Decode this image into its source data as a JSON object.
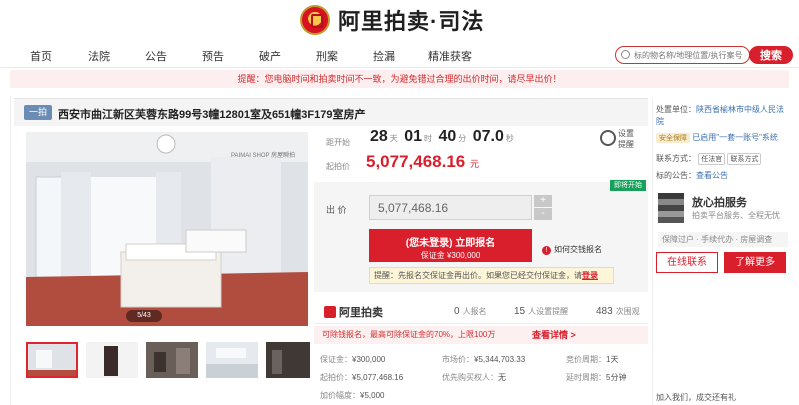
{
  "header": {
    "logo_text": "阿里拍卖·司法"
  },
  "nav": {
    "items": [
      "首页",
      "法院",
      "公告",
      "预告",
      "破产",
      "刑案",
      "捡漏",
      "精准获客"
    ],
    "search_placeholder": "标的物名称/地理位置/执行案号",
    "search_button": "搜索"
  },
  "notice": "提醒：您电脑时间和拍卖时间不一致，为避免错过合理的出价时间，请尽早出价！",
  "title": {
    "tag": "一拍",
    "text": "西安市曲江新区芙蓉东路99号3幢12801室及651幢3F179室房产"
  },
  "photo": {
    "counter": "5/43"
  },
  "auction": {
    "countdown_label": "距开始",
    "days": "28",
    "days_unit": "天",
    "hours": "01",
    "hours_unit": "时",
    "minutes": "40",
    "minutes_unit": "分",
    "seconds": "07.0",
    "seconds_unit": "秒",
    "start_price_label": "起拍价",
    "start_price": "5,077,468.16",
    "price_unit": "元",
    "remind_label": "设置提醒",
    "status_tag": "即将开始",
    "bid_label": "出  价",
    "bid_value": "5,077,468.16",
    "step_up": "+",
    "step_down": "-",
    "register_button": "(您未登录) 立即报名",
    "register_sub": "保证金 ¥300,000",
    "howto_link": "如何交钱报名",
    "hint_prefix": "提醒：先报名交保证金再出价。如果您已经交付保证金，请",
    "hint_login": "登录"
  },
  "stats": {
    "brand": "阿里拍卖",
    "enrolled": "0",
    "enrolled_label": "人报名",
    "reminders": "15",
    "reminders_label": "人设置提醒",
    "views": "483",
    "views_label": "次围观"
  },
  "promo": {
    "text": "可除钱报名，最高可除保证金的70%，上限100万",
    "view": "查看详情 >"
  },
  "details": {
    "deposit_label": "保证金：",
    "deposit": "¥300,000",
    "market_label": "市场价：",
    "market": "¥5,344,703.33",
    "period_label": "竞价周期：",
    "period": "1天",
    "start_label": "起拍价：",
    "start": "¥5,077,468.16",
    "priority_label": "优先购买权人：",
    "priority": "无",
    "delay_label": "延时周期：",
    "delay": "5分钟",
    "increment_label": "加价幅度：",
    "increment": "¥5,000"
  },
  "side": {
    "court_label": "处置单位：",
    "court_name": "陕西省榆林市中级人民法院",
    "credit_badge": "安全保障",
    "credit_text": "已启用\"一套一账号\"系统",
    "contact_label": "联系方式：",
    "contact_person": "任法官",
    "contact_button": "联系方式",
    "notice_label": "标的公告：",
    "notice_link": "查看公告",
    "service_title": "放心拍服务",
    "service_sub": "拍卖平台服务、全程无忧",
    "service_tags": "保障过户 · 手续代办 · 房屋调查",
    "online_button": "在线联系",
    "more_button": "了解更多",
    "bottom_link": "加入我们，成交还有礼"
  }
}
